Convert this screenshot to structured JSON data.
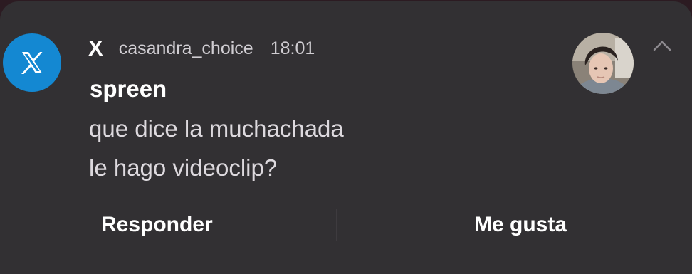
{
  "notification": {
    "app_name": "X",
    "account": "casandra_choice",
    "time": "18:01",
    "sender": "spreen",
    "message_lines": [
      "que dice la muchachada",
      "le hago videoclip?"
    ],
    "icons": {
      "app": "x-logo-icon",
      "expand": "chevron-up-icon",
      "avatar": "avatar"
    },
    "actions": {
      "reply_label": "Responder",
      "like_label": "Me gusta"
    },
    "colors": {
      "card_background": "#323033",
      "app_icon_background": "#1488d2",
      "primary_text": "#ffffff",
      "secondary_text": "#d0cdd2"
    }
  }
}
